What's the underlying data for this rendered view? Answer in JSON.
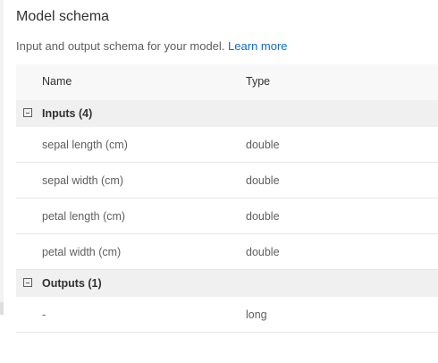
{
  "title": "Model schema",
  "description": {
    "text": "Input and output schema for your model.",
    "link": "Learn more"
  },
  "columns": {
    "name": "Name",
    "type": "Type"
  },
  "inputs": {
    "label": "Inputs (4)",
    "rows": [
      {
        "name": "sepal length (cm)",
        "type": "double"
      },
      {
        "name": "sepal width (cm)",
        "type": "double"
      },
      {
        "name": "petal length (cm)",
        "type": "double"
      },
      {
        "name": "petal width (cm)",
        "type": "double"
      }
    ]
  },
  "outputs": {
    "label": "Outputs (1)",
    "rows": [
      {
        "name": "-",
        "type": "long"
      }
    ]
  }
}
